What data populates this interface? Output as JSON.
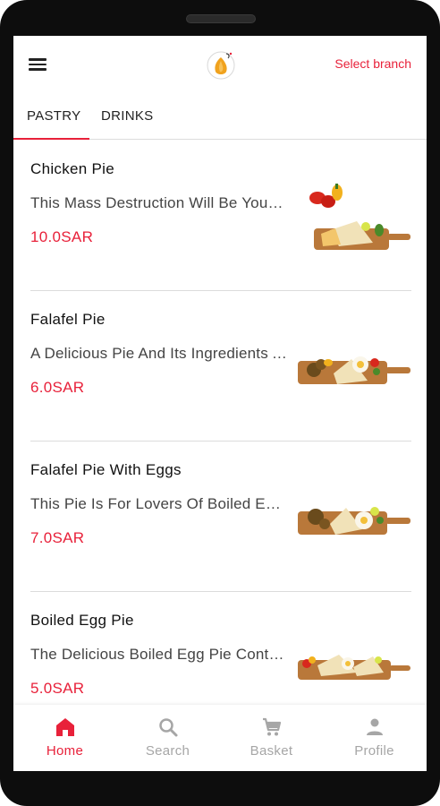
{
  "header": {
    "select_branch": "Select branch",
    "menu_icon": "hamburger-menu-icon",
    "logo": "brand-logo"
  },
  "tabs": [
    {
      "label": "PASTRY",
      "active": true
    },
    {
      "label": "DRINKS",
      "active": false
    }
  ],
  "items": [
    {
      "name": "Chicken Pie",
      "description": "This Mass Destruction Will Be Your Favorite Pie",
      "price": "10.0SAR"
    },
    {
      "name": "Falafel Pie",
      "description": "A Delicious Pie And Its Ingredients Are Falafel",
      "price": "6.0SAR"
    },
    {
      "name": "Falafel Pie With Eggs",
      "description": "This Pie Is For Lovers Of Boiled Eggs And Falafel",
      "price": "7.0SAR"
    },
    {
      "name": "Boiled Egg Pie",
      "description": "The Delicious Boiled Egg Pie Contains Boiled Eggs",
      "price": "5.0SAR"
    }
  ],
  "bottom_nav": [
    {
      "label": "Home",
      "icon": "home-icon",
      "active": true
    },
    {
      "label": "Search",
      "icon": "search-icon",
      "active": false
    },
    {
      "label": "Basket",
      "icon": "cart-icon",
      "active": false
    },
    {
      "label": "Profile",
      "icon": "person-icon",
      "active": false
    }
  ],
  "colors": {
    "accent": "#e8213a",
    "inactive": "#a6a6a6",
    "board": "#b9783a"
  }
}
